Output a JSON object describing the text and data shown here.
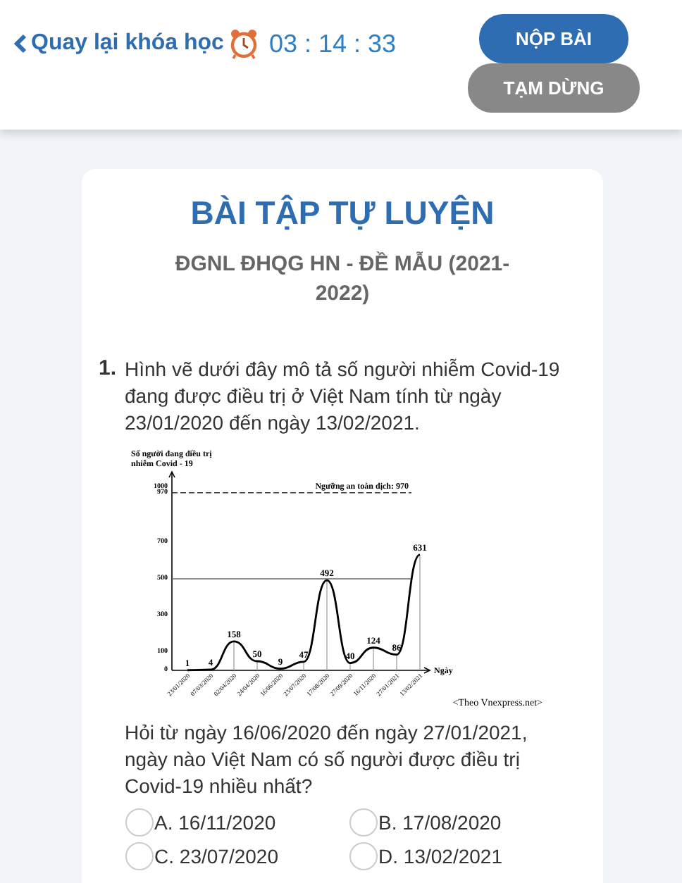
{
  "header": {
    "back_label": "Quay lại khóa học",
    "timer": "03 : 14 : 33",
    "buttons": [
      {
        "label": "NỘP BÀI",
        "kind": "primary"
      },
      {
        "label": "TẠM DỪNG",
        "kind": "secondary"
      }
    ]
  },
  "exercise": {
    "title": "BÀI TẬP TỰ LUYỆN",
    "subtitle": "ĐGNL ĐHQG HN - ĐỀ MẪU (2021-2022)"
  },
  "question": {
    "number": "1.",
    "intro": "Hình vẽ dưới đây mô tả số người nhiễm Covid-19 đang được điều trị ở Việt Nam tính từ ngày 23/01/2020 đến ngày 13/02/2021.",
    "chart_data": {
      "type": "line",
      "ylabel": "Số người đang điều trị nhiễm Covid - 19",
      "xlabel": "Ngày",
      "categories": [
        "23/01/2020",
        "07/03/2020",
        "02/04/2020",
        "24/04/2020",
        "16/06/2020",
        "23/07/2020",
        "17/08/2020",
        "27/09/2020",
        "16/11/2020",
        "27/01/2021",
        "13/02/2021"
      ],
      "series": [
        {
          "color": "#000000",
          "values": [
            1,
            4,
            158,
            50,
            9,
            47,
            492,
            40,
            124,
            86,
            631
          ]
        }
      ],
      "ylim": [
        0,
        1000
      ],
      "yticks": [
        0,
        100,
        300,
        500,
        700,
        970,
        1000
      ],
      "data_labels": true,
      "ref_lines": [
        {
          "axis": "y",
          "value": 970,
          "label": "Ngưỡng an toàn dịch: 970"
        },
        {
          "axis": "y",
          "value": 500
        }
      ]
    },
    "source": "<Theo Vnexpress.net>",
    "prompt": "Hỏi từ ngày 16/06/2020 đến ngày 27/01/2021, ngày nào Việt Nam có số người được điều trị Covid-19 nhiều nhất?",
    "options": [
      {
        "label": "A. 16/11/2020",
        "selected": false
      },
      {
        "label": "B. 17/08/2020",
        "selected": false
      },
      {
        "label": "C. 23/07/2020",
        "selected": false
      },
      {
        "label": "D. 13/02/2021",
        "selected": false
      }
    ]
  }
}
